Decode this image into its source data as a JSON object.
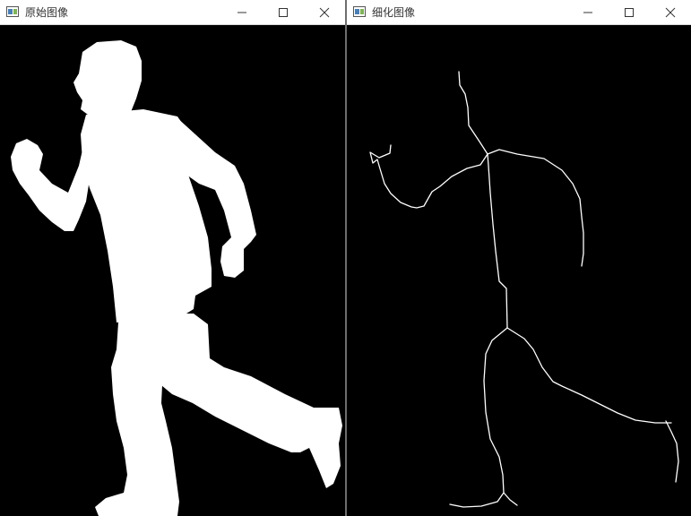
{
  "windows": [
    {
      "title": "原始图像",
      "image": "binary-silhouette-running-man"
    },
    {
      "title": "细化图像",
      "image": "thinned-skeleton-running-man"
    }
  ],
  "controls": {
    "minimize": "minimize-icon",
    "maximize": "maximize-icon",
    "close": "close-icon"
  },
  "colors": {
    "titlebar": "#ffffff",
    "canvas": "#000000",
    "foreground": "#ffffff",
    "separator": "#6e6e6e"
  }
}
